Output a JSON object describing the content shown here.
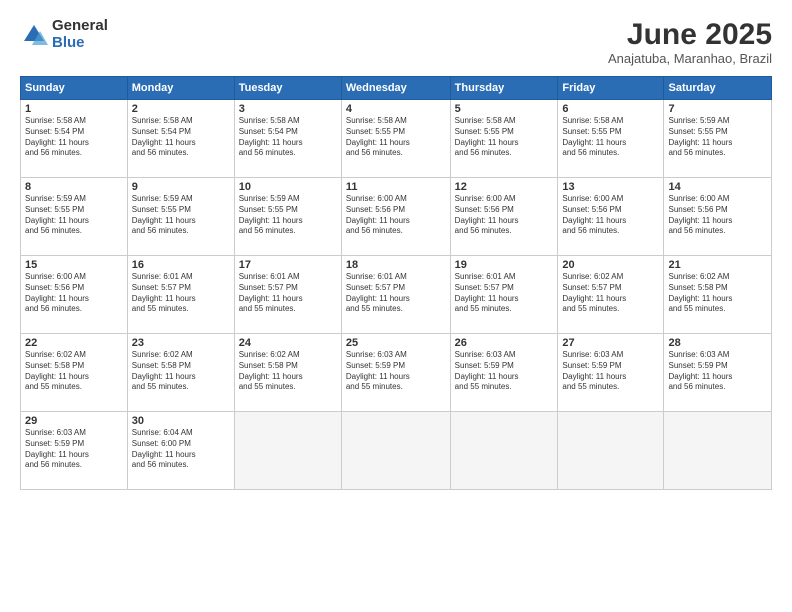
{
  "logo": {
    "general": "General",
    "blue": "Blue"
  },
  "title": "June 2025",
  "subtitle": "Anajatuba, Maranhao, Brazil",
  "headers": [
    "Sunday",
    "Monday",
    "Tuesday",
    "Wednesday",
    "Thursday",
    "Friday",
    "Saturday"
  ],
  "weeks": [
    [
      {
        "day": "1",
        "info": "Sunrise: 5:58 AM\nSunset: 5:54 PM\nDaylight: 11 hours\nand 56 minutes."
      },
      {
        "day": "2",
        "info": "Sunrise: 5:58 AM\nSunset: 5:54 PM\nDaylight: 11 hours\nand 56 minutes."
      },
      {
        "day": "3",
        "info": "Sunrise: 5:58 AM\nSunset: 5:54 PM\nDaylight: 11 hours\nand 56 minutes."
      },
      {
        "day": "4",
        "info": "Sunrise: 5:58 AM\nSunset: 5:55 PM\nDaylight: 11 hours\nand 56 minutes."
      },
      {
        "day": "5",
        "info": "Sunrise: 5:58 AM\nSunset: 5:55 PM\nDaylight: 11 hours\nand 56 minutes."
      },
      {
        "day": "6",
        "info": "Sunrise: 5:58 AM\nSunset: 5:55 PM\nDaylight: 11 hours\nand 56 minutes."
      },
      {
        "day": "7",
        "info": "Sunrise: 5:59 AM\nSunset: 5:55 PM\nDaylight: 11 hours\nand 56 minutes."
      }
    ],
    [
      {
        "day": "8",
        "info": "Sunrise: 5:59 AM\nSunset: 5:55 PM\nDaylight: 11 hours\nand 56 minutes."
      },
      {
        "day": "9",
        "info": "Sunrise: 5:59 AM\nSunset: 5:55 PM\nDaylight: 11 hours\nand 56 minutes."
      },
      {
        "day": "10",
        "info": "Sunrise: 5:59 AM\nSunset: 5:55 PM\nDaylight: 11 hours\nand 56 minutes."
      },
      {
        "day": "11",
        "info": "Sunrise: 6:00 AM\nSunset: 5:56 PM\nDaylight: 11 hours\nand 56 minutes."
      },
      {
        "day": "12",
        "info": "Sunrise: 6:00 AM\nSunset: 5:56 PM\nDaylight: 11 hours\nand 56 minutes."
      },
      {
        "day": "13",
        "info": "Sunrise: 6:00 AM\nSunset: 5:56 PM\nDaylight: 11 hours\nand 56 minutes."
      },
      {
        "day": "14",
        "info": "Sunrise: 6:00 AM\nSunset: 5:56 PM\nDaylight: 11 hours\nand 56 minutes."
      }
    ],
    [
      {
        "day": "15",
        "info": "Sunrise: 6:00 AM\nSunset: 5:56 PM\nDaylight: 11 hours\nand 56 minutes."
      },
      {
        "day": "16",
        "info": "Sunrise: 6:01 AM\nSunset: 5:57 PM\nDaylight: 11 hours\nand 55 minutes."
      },
      {
        "day": "17",
        "info": "Sunrise: 6:01 AM\nSunset: 5:57 PM\nDaylight: 11 hours\nand 55 minutes."
      },
      {
        "day": "18",
        "info": "Sunrise: 6:01 AM\nSunset: 5:57 PM\nDaylight: 11 hours\nand 55 minutes."
      },
      {
        "day": "19",
        "info": "Sunrise: 6:01 AM\nSunset: 5:57 PM\nDaylight: 11 hours\nand 55 minutes."
      },
      {
        "day": "20",
        "info": "Sunrise: 6:02 AM\nSunset: 5:57 PM\nDaylight: 11 hours\nand 55 minutes."
      },
      {
        "day": "21",
        "info": "Sunrise: 6:02 AM\nSunset: 5:58 PM\nDaylight: 11 hours\nand 55 minutes."
      }
    ],
    [
      {
        "day": "22",
        "info": "Sunrise: 6:02 AM\nSunset: 5:58 PM\nDaylight: 11 hours\nand 55 minutes."
      },
      {
        "day": "23",
        "info": "Sunrise: 6:02 AM\nSunset: 5:58 PM\nDaylight: 11 hours\nand 55 minutes."
      },
      {
        "day": "24",
        "info": "Sunrise: 6:02 AM\nSunset: 5:58 PM\nDaylight: 11 hours\nand 55 minutes."
      },
      {
        "day": "25",
        "info": "Sunrise: 6:03 AM\nSunset: 5:59 PM\nDaylight: 11 hours\nand 55 minutes."
      },
      {
        "day": "26",
        "info": "Sunrise: 6:03 AM\nSunset: 5:59 PM\nDaylight: 11 hours\nand 55 minutes."
      },
      {
        "day": "27",
        "info": "Sunrise: 6:03 AM\nSunset: 5:59 PM\nDaylight: 11 hours\nand 55 minutes."
      },
      {
        "day": "28",
        "info": "Sunrise: 6:03 AM\nSunset: 5:59 PM\nDaylight: 11 hours\nand 56 minutes."
      }
    ],
    [
      {
        "day": "29",
        "info": "Sunrise: 6:03 AM\nSunset: 5:59 PM\nDaylight: 11 hours\nand 56 minutes."
      },
      {
        "day": "30",
        "info": "Sunrise: 6:04 AM\nSunset: 6:00 PM\nDaylight: 11 hours\nand 56 minutes."
      },
      {
        "day": "",
        "info": ""
      },
      {
        "day": "",
        "info": ""
      },
      {
        "day": "",
        "info": ""
      },
      {
        "day": "",
        "info": ""
      },
      {
        "day": "",
        "info": ""
      }
    ]
  ]
}
